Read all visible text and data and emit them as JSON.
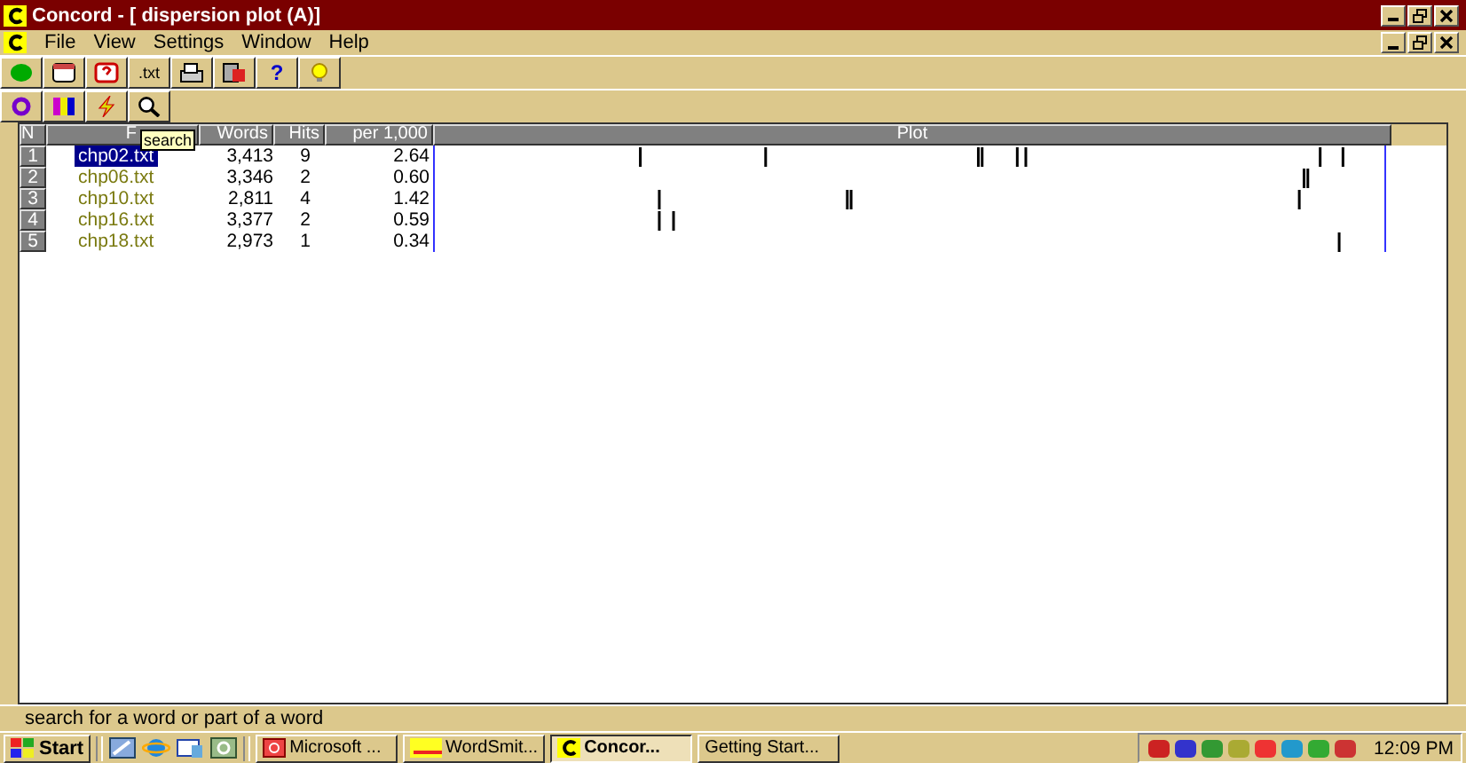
{
  "window": {
    "title": "Concord - [ dispersion plot (A)]"
  },
  "menu": [
    "File",
    "View",
    "Settings",
    "Window",
    "Help"
  ],
  "toolbar": [
    {
      "kind": "icon"
    },
    {
      "kind": "icon"
    },
    {
      "kind": "icon"
    },
    {
      "kind": "text",
      "label": ".txt"
    },
    {
      "kind": "icon"
    },
    {
      "kind": "icon"
    },
    {
      "kind": "text",
      "label": "?"
    },
    {
      "kind": "icon"
    }
  ],
  "toolbar2": [
    {
      "kind": "icon"
    },
    {
      "kind": "icon"
    },
    {
      "kind": "icon"
    },
    {
      "kind": "icon"
    }
  ],
  "tooltip": "search",
  "table": {
    "columns": [
      "N",
      "F",
      "Words",
      "Hits",
      "per 1,000",
      "Plot"
    ],
    "rows": [
      {
        "n": "1",
        "file": "chp02.txt",
        "words": "3,413",
        "hits": "9",
        "per": "2.64",
        "selected": true
      },
      {
        "n": "2",
        "file": "chp06.txt",
        "words": "3,346",
        "hits": "2",
        "per": "0.60",
        "selected": false
      },
      {
        "n": "3",
        "file": "chp10.txt",
        "words": "2,811",
        "hits": "4",
        "per": "1.42",
        "selected": false
      },
      {
        "n": "4",
        "file": "chp16.txt",
        "words": "3,377",
        "hits": "2",
        "per": "0.59",
        "selected": false
      },
      {
        "n": "5",
        "file": "chp18.txt",
        "words": "2,973",
        "hits": "1",
        "per": "0.34",
        "selected": false
      }
    ]
  },
  "status_bar": "search for a word or part of a word",
  "taskbar": {
    "start": "Start",
    "tasks": [
      {
        "label": "Microsoft ...",
        "selected": false
      },
      {
        "label": "WordSmit...",
        "selected": false
      },
      {
        "label": "Concor...",
        "selected": true
      },
      {
        "label": "Getting Start...",
        "selected": false
      }
    ],
    "time": "12:09 PM"
  }
}
